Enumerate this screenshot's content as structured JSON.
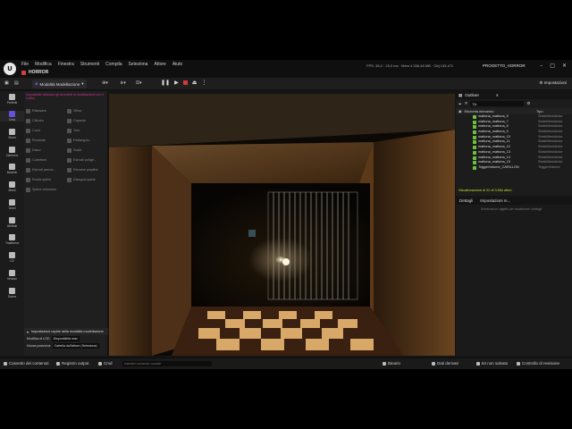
{
  "menu": [
    "File",
    "Modifica",
    "Finestra",
    "Strumenti",
    "Compila",
    "Seleziona",
    "Attore",
    "Aiuto"
  ],
  "doc_tab": "HORROR",
  "stats": "FPS: 38,0 · 29,0 ms · Mem 4.336,48 MB · Obj 133.471",
  "project": "PROGETTO_HORROR",
  "toolbar": {
    "mode": "Modalità Modellazione",
    "settings": "Impostazioni"
  },
  "left_tools": [
    {
      "label": "Preferiti",
      "icon": "star-icon"
    },
    {
      "label": "Crea",
      "icon": "create-icon"
    },
    {
      "label": "Xform",
      "icon": "transform-icon"
    },
    {
      "label": "Deforma",
      "icon": "deform-icon"
    },
    {
      "label": "Modello",
      "icon": "model-icon"
    },
    {
      "label": "Mesh",
      "icon": "mesh-icon"
    },
    {
      "label": "Voxel",
      "icon": "voxel-icon"
    },
    {
      "label": "Attributi",
      "icon": "attributes-icon"
    },
    {
      "label": "Trasforma",
      "icon": "transform-uv-icon"
    },
    {
      "label": "UV",
      "icon": "uv-icon"
    },
    {
      "label": "Version",
      "icon": "version-icon"
    },
    {
      "label": "Scene",
      "icon": "scene-icon"
    }
  ],
  "modeling": {
    "warning": "Impossibile utilizzare gli strumenti di modellazione con il Livello",
    "tools": [
      "Rilassare",
      "Sfera",
      "Cilindro",
      "Capsule",
      "Cono",
      "Toro",
      "Piramide",
      "Rettangolo",
      "Disco",
      "Scale",
      "Cubettoni",
      "Estrudi polige...",
      "Estrudi percor...",
      "Revolve polyline",
      "Ruota spline",
      "Disegna spline",
      "Spline estrusion"
    ],
    "quick_header": "Impostazioni rapide della modalità modellazione",
    "lod_label": "Modifica di LOD",
    "lod_value": "Disponibilità max",
    "new_pos_label": "Nuova posizione",
    "new_pos_value": "Cartella dull'attore (Seleziona)"
  },
  "outliner": {
    "title": "Outliner",
    "search": "TA",
    "col_name": "Etichetta elemento",
    "col_type": "Tipo",
    "rows": [
      {
        "name": "mattona_mattona_5",
        "type": "StaticMeshActor"
      },
      {
        "name": "mattona_mattona_7",
        "type": "StaticMeshActor"
      },
      {
        "name": "mattona_mattona_8",
        "type": "StaticMeshActor"
      },
      {
        "name": "mattona_mattona_9",
        "type": "StaticMeshActor"
      },
      {
        "name": "mattona_mattona_10",
        "type": "StaticMeshActor"
      },
      {
        "name": "mattona_mattona_11",
        "type": "StaticMeshActor"
      },
      {
        "name": "mattona_mattona_12",
        "type": "StaticMeshActor"
      },
      {
        "name": "mattona_mattona_13",
        "type": "StaticMeshActor"
      },
      {
        "name": "mattona_mattona_14",
        "type": "StaticMeshActor"
      },
      {
        "name": "mattona_mattona_15",
        "type": "StaticMeshActor"
      },
      {
        "name": "TriggerVolume_CARILLON",
        "type": "TriggerVolume"
      }
    ],
    "footer": "Visualizzazione di 22 di 3.554 attori"
  },
  "details": {
    "tab1": "Dettagli",
    "tab2": "Impostazioni m...",
    "empty": "Seleziona un oggetto per visualizzare i dettagli"
  },
  "statusbar": {
    "content": "Cassetto dei contenuti",
    "output": "Registro output",
    "cmd": "Cmd",
    "console_placeholder": "Inserisci comando console",
    "binary": "Binario",
    "derived": "Dati derivati",
    "unsaved": "84 non salvato",
    "revision": "Controllo di revisione"
  },
  "colors": {
    "accent": "#6a4fd8",
    "warning": "#d1349a",
    "footer": "#c8e02a"
  }
}
